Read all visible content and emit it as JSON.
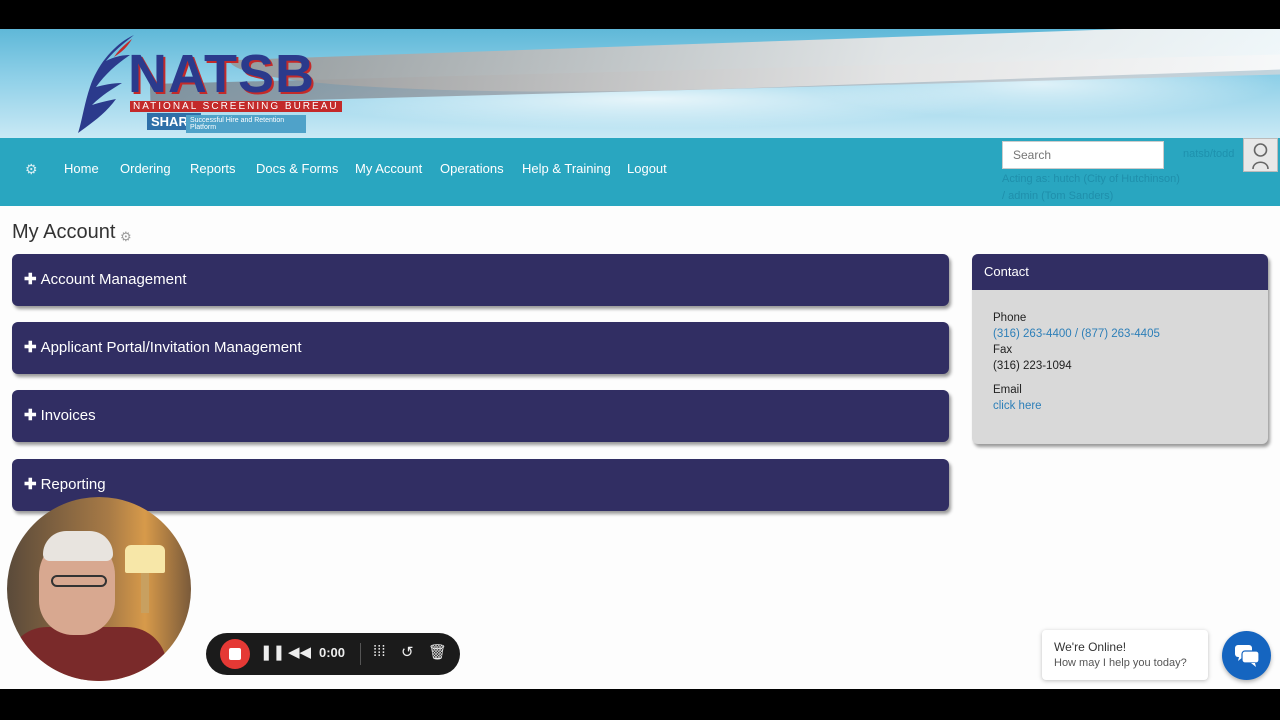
{
  "brand": {
    "name": "NATSB",
    "subtitle": "NATIONAL SCREENING BUREAU",
    "product": "SHARP",
    "tagline": "Successful Hire and Retention Platform"
  },
  "nav": {
    "items": [
      "Home",
      "Ordering",
      "Reports",
      "Docs & Forms",
      "My Account",
      "Operations",
      "Help & Training",
      "Logout"
    ],
    "search_placeholder": "Search",
    "user": "natsb/todd",
    "acting_line1": "Acting as: hutch (City of Hutchinson)",
    "acting_line2": "/ admin (Tom Sanders)"
  },
  "page": {
    "title": "My Account"
  },
  "panels": [
    {
      "label": "Account Management"
    },
    {
      "label": "Applicant Portal/Invitation Management"
    },
    {
      "label": "Invoices"
    },
    {
      "label": "Reporting"
    }
  ],
  "contact": {
    "title": "Contact",
    "phone_label": "Phone",
    "phone_value": "(316) 263-4400 / (877) 263-4405",
    "fax_label": "Fax",
    "fax_value": "(316) 223-1094",
    "email_label": "Email",
    "email_link": "click here"
  },
  "recorder": {
    "time": "0:00"
  },
  "chat": {
    "title": "We're Online!",
    "subtitle": "How may I help you today?"
  },
  "colors": {
    "nav_bg": "#29a6c0",
    "panel_bg": "#312e63",
    "link": "#2d7fb8",
    "record_red": "#e53935",
    "chat_blue": "#1565c0"
  }
}
